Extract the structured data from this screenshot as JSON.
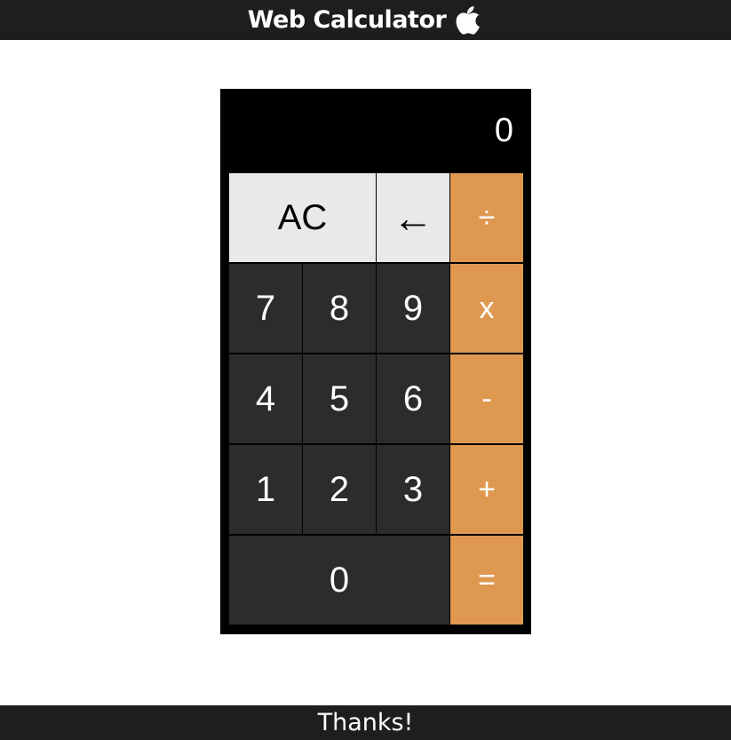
{
  "header": {
    "title": "Web Calculator",
    "logo_icon": "apple-icon"
  },
  "calculator": {
    "display_value": "0",
    "keys": {
      "ac": "AC",
      "backspace": "←",
      "divide": "÷",
      "seven": "7",
      "eight": "8",
      "nine": "9",
      "multiply": "x",
      "four": "4",
      "five": "5",
      "six": "6",
      "subtract": "-",
      "one": "1",
      "two": "2",
      "three": "3",
      "add": "+",
      "zero": "0",
      "equals": "="
    },
    "colors": {
      "body": "#000000",
      "number_key": "#2c2c2f",
      "function_key": "#e9e9eb",
      "operator_key": "#df9850"
    }
  },
  "footer": {
    "text": "Thanks!"
  }
}
